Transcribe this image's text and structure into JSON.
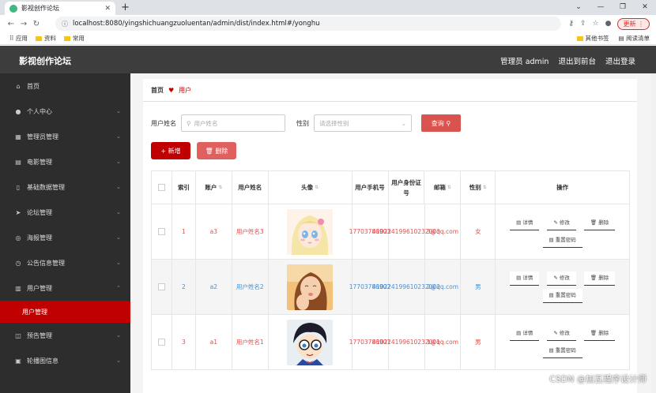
{
  "browser": {
    "tab_title": "影视创作论坛",
    "tab_close": "✕",
    "new_tab": "+",
    "url": "localhost:8080/yingshichuangzuoluentan/admin/dist/index.html#/yonghu",
    "update_label": "更新",
    "bookmarks": [
      "应用",
      "资料",
      "常用"
    ],
    "bookmarks_right": [
      "其他书签",
      "阅读清单"
    ]
  },
  "header": {
    "logo": "影视创作论坛",
    "nav": [
      "管理员 admin",
      "退出到前台",
      "退出登录"
    ]
  },
  "sidebar": {
    "items": [
      {
        "label": "首页",
        "icon": "home-icon"
      },
      {
        "label": "个人中心",
        "icon": "user-icon"
      },
      {
        "label": "管理员管理",
        "icon": "admin-icon"
      },
      {
        "label": "电影管理",
        "icon": "film-icon"
      },
      {
        "label": "基础数据管理",
        "icon": "data-icon"
      },
      {
        "label": "论坛管理",
        "icon": "forum-icon"
      },
      {
        "label": "海报管理",
        "icon": "poster-icon"
      },
      {
        "label": "公告信息管理",
        "icon": "notice-icon"
      },
      {
        "label": "用户管理",
        "icon": "users-icon"
      }
    ],
    "active_sub": "用户管理",
    "after": [
      {
        "label": "预告管理",
        "icon": "trailer-icon"
      },
      {
        "label": "轮播图信息",
        "icon": "carousel-icon"
      }
    ]
  },
  "breadcrumb": {
    "home": "首页",
    "current": "用户"
  },
  "search": {
    "name_label": "用户姓名",
    "name_placeholder": "用户姓名",
    "gender_label": "性别",
    "gender_placeholder": "请选择性别",
    "query_button": "查询"
  },
  "actions": {
    "add": "+ 新增",
    "delete": "删除"
  },
  "table": {
    "headers": [
      "索引",
      "账户",
      "用户姓名",
      "头像",
      "用户手机号",
      "用户身份证号",
      "邮箱",
      "性别",
      "操作"
    ],
    "rows": [
      {
        "index": "1",
        "account": "a3",
        "name": "用户姓名3",
        "phone": "17703786903",
        "idcard": "410224199610232003",
        "email": "3@qq.com",
        "gender": "女"
      },
      {
        "index": "2",
        "account": "a2",
        "name": "用户姓名2",
        "phone": "17703786902",
        "idcard": "410224199610232002",
        "email": "2@qq.com",
        "gender": "男"
      },
      {
        "index": "3",
        "account": "a1",
        "name": "用户姓名1",
        "phone": "17703786901",
        "idcard": "410224199610232001",
        "email": "1@qq.com",
        "gender": "男"
      }
    ],
    "ops": {
      "detail": "详情",
      "edit": "修改",
      "delete": "删除",
      "reset": "重置密码"
    }
  },
  "watermark": "CSDN @加瓦程序设计师"
}
